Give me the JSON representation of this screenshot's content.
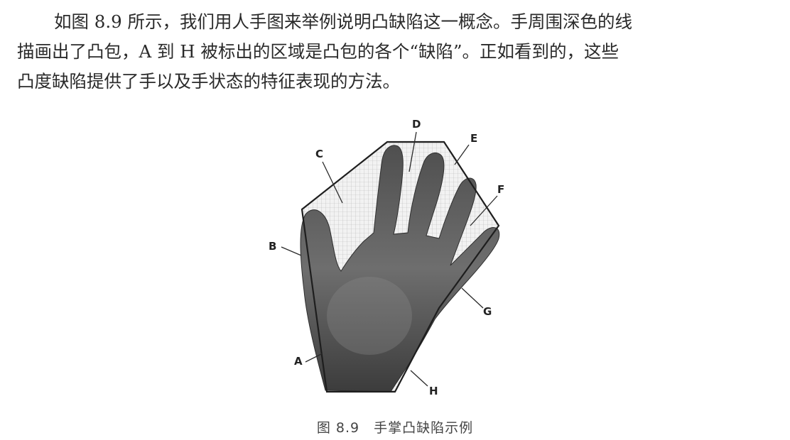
{
  "paragraph": {
    "lines": [
      "如图 8.9 所示，我们用人手图来举例说明凸缺陷这一概念。手周围深色的线",
      "描画出了凸包，A 到 H 被标出的区域是凸包的各个“缺陷”。正如看到的，这些",
      "凸度缺陷提供了手以及手状态的特征表现的方法。"
    ]
  },
  "figure": {
    "labels": {
      "a": "A",
      "b": "B",
      "c": "C",
      "d": "D",
      "e": "E",
      "f": "F",
      "g": "G",
      "h": "H"
    },
    "caption": "图 8.9　手掌凸缺陷示例"
  }
}
